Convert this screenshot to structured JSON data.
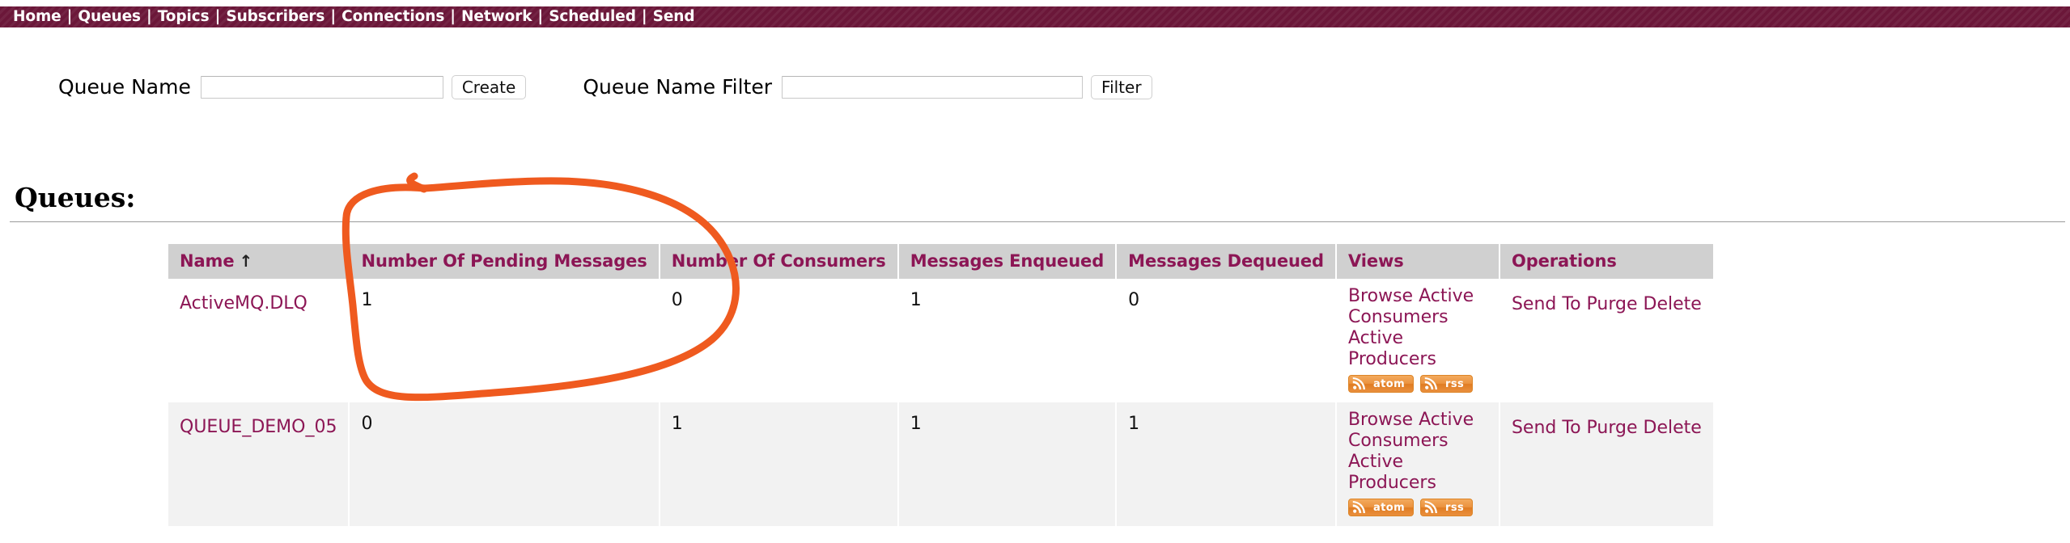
{
  "nav": {
    "separator": "|",
    "items": [
      {
        "label": "Home"
      },
      {
        "label": "Queues"
      },
      {
        "label": "Topics"
      },
      {
        "label": "Subscribers"
      },
      {
        "label": "Connections"
      },
      {
        "label": "Network"
      },
      {
        "label": "Scheduled"
      },
      {
        "label": "Send"
      }
    ]
  },
  "form": {
    "queue_name_label": "Queue Name",
    "queue_name_value": "",
    "create_label": "Create",
    "filter_label_text": "Queue Name Filter",
    "filter_value": "",
    "filter_button_label": "Filter"
  },
  "page": {
    "heading": "Queues:"
  },
  "table": {
    "headers": [
      {
        "label": "Name",
        "sort_arrow": "↑"
      },
      {
        "label": "Number Of Pending Messages"
      },
      {
        "label": "Number Of Consumers"
      },
      {
        "label": "Messages Enqueued"
      },
      {
        "label": "Messages Dequeued"
      },
      {
        "label": "Views"
      },
      {
        "label": "Operations"
      }
    ],
    "rows": [
      {
        "name": "ActiveMQ.DLQ",
        "pending": "1",
        "consumers": "0",
        "enqueued": "1",
        "dequeued": "0",
        "views": [
          "Browse",
          "Active Consumers",
          "Active Producers"
        ],
        "feeds": [
          {
            "label": "atom"
          },
          {
            "label": "rss"
          }
        ],
        "operations": [
          "Send To",
          "Purge",
          "Delete"
        ]
      },
      {
        "name": "QUEUE_DEMO_05",
        "pending": "0",
        "consumers": "1",
        "enqueued": "1",
        "dequeued": "1",
        "views": [
          "Browse",
          "Active Consumers",
          "Active Producers"
        ],
        "feeds": [
          {
            "label": "atom"
          },
          {
            "label": "rss"
          }
        ],
        "operations": [
          "Send To",
          "Purge",
          "Delete"
        ]
      }
    ]
  },
  "annotation": {
    "shape": "hand-drawn-ellipse",
    "color": "#ef5a1f",
    "target": "Number Of Pending Messages"
  },
  "colors": {
    "nav_background": "#6b1739",
    "link": "#8c1655",
    "header_background": "#d0d0d0",
    "alt_row_background": "#f2f2f2",
    "feed_badge": "#e68a33",
    "annotation": "#ef5a1f"
  }
}
